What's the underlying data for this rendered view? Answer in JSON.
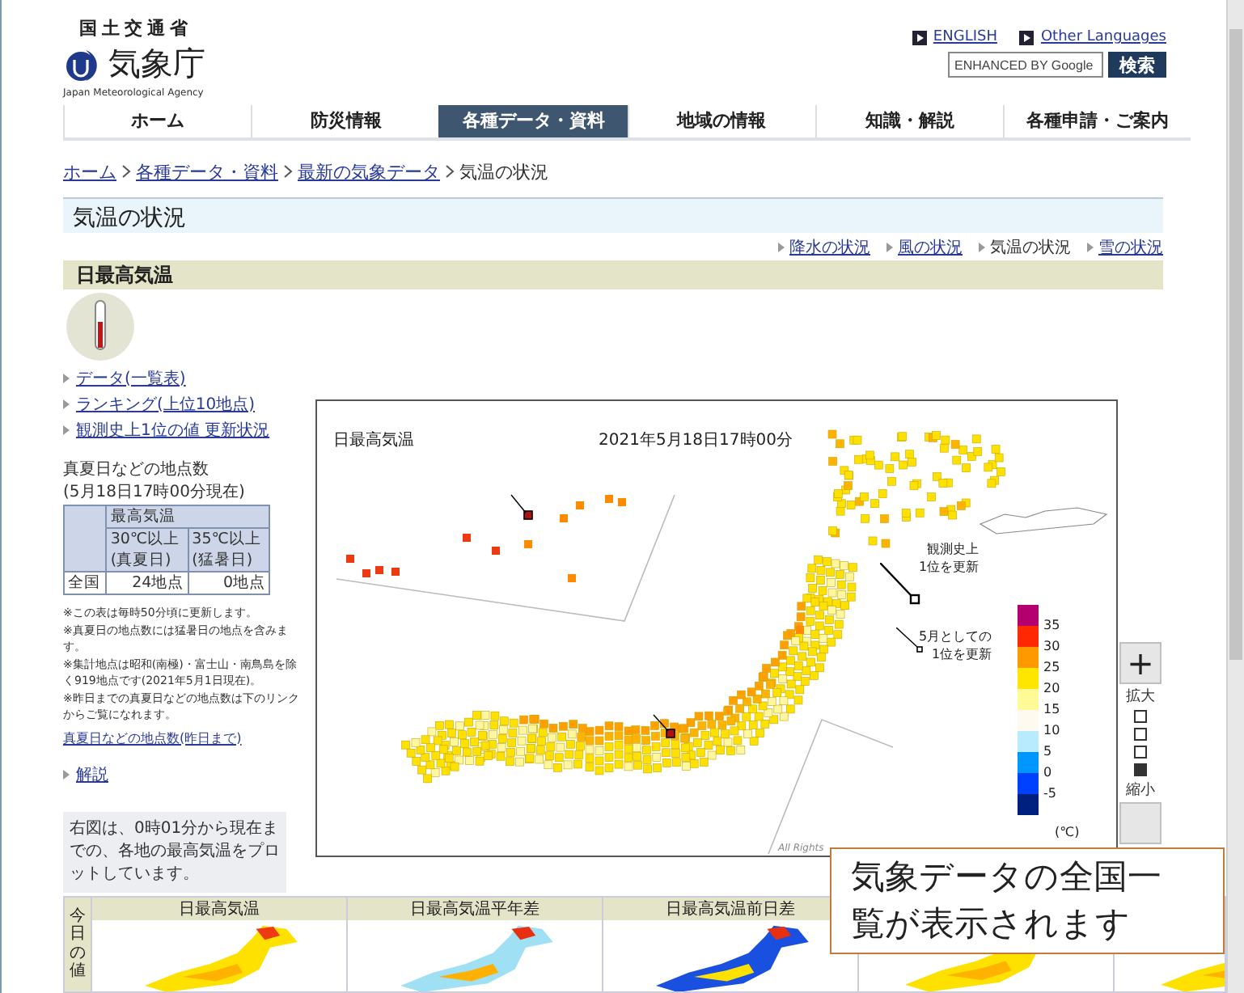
{
  "header": {
    "ministry": "国土交通省",
    "agency": "気象庁",
    "agency_en": "Japan Meteorological Agency",
    "links": [
      "ENGLISH",
      "Other Languages"
    ],
    "search": {
      "placeholder": "ENHANCED BY Google",
      "button": "検索"
    }
  },
  "nav": [
    {
      "label": "ホーム",
      "selected": false
    },
    {
      "label": "防災情報",
      "selected": false
    },
    {
      "label": "各種データ・資料",
      "selected": true
    },
    {
      "label": "地域の情報",
      "selected": false
    },
    {
      "label": "知識・解説",
      "selected": false
    },
    {
      "label": "各種申請・ご案内",
      "selected": false
    }
  ],
  "breadcrumb": [
    {
      "label": "ホーム",
      "current": false
    },
    {
      "label": "各種データ・資料",
      "current": false
    },
    {
      "label": "最新の気象データ",
      "current": false
    },
    {
      "label": "気温の状況",
      "current": true
    }
  ],
  "page_title": "気温の状況",
  "sub_links": [
    {
      "label": "降水の状況",
      "selected": false
    },
    {
      "label": "風の状況",
      "selected": false
    },
    {
      "label": "気温の状況",
      "selected": true
    },
    {
      "label": "雪の状況",
      "selected": false
    }
  ],
  "section_title": "日最高気温",
  "side_links": [
    "データ(一覧表)",
    "ランキング(上位10地点)",
    "観測史上1位の値 更新状況"
  ],
  "counts": {
    "title": "真夏日などの地点数",
    "as_of": "(5月18日17時00分現在)",
    "group": "最高気温",
    "columns": [
      [
        "30℃以上",
        "(真夏日)"
      ],
      [
        "35℃以上",
        "(猛暑日)"
      ]
    ],
    "rows": [
      {
        "region": "全国",
        "values": [
          "24地点",
          "0地点"
        ]
      }
    ]
  },
  "notes": [
    "※この表は毎時50分頃に更新します。",
    "※真夏日の地点数には猛暑日の地点を含みます。",
    "※集計地点は昭和(南極)・富士山・南鳥島を除く919地点です(2021年5月1日現在)。",
    "※昨日までの真夏日などの地点数は下のリンクからご覧になれます。"
  ],
  "past_link": "真夏日などの地点数(昨日まで)",
  "explain_link": "解説",
  "info": "右図は、0時01分から現在までの、各地の最高気温をプロットしています。",
  "map": {
    "title": "日最高気温",
    "time": "2021年5月18日17時00分",
    "annotations": [
      {
        "kind": "record",
        "lines": [
          "観測史上",
          "1位を更新"
        ]
      },
      {
        "kind": "month",
        "lines": [
          "5月としての",
          "1位を更新"
        ]
      }
    ],
    "legend": [
      {
        "label": "35",
        "color": "#b4006e"
      },
      {
        "label": "30",
        "color": "#ff2800"
      },
      {
        "label": "25",
        "color": "#ff9900"
      },
      {
        "label": "20",
        "color": "#ffe600"
      },
      {
        "label": "15",
        "color": "#fffa96"
      },
      {
        "label": "10",
        "color": "#fffaf0"
      },
      {
        "label": "5",
        "color": "#b9ebff"
      },
      {
        "label": "0",
        "color": "#0096ff"
      },
      {
        "label": "-5",
        "color": "#0041ff"
      },
      {
        "color": "#002080"
      }
    ],
    "unit": "(℃)",
    "copyright": "All Rights"
  },
  "zoom": {
    "in": "+",
    "in_label": "拡大",
    "levels": [
      {
        "selected": false
      },
      {
        "selected": false
      },
      {
        "selected": false
      },
      {
        "selected": true
      }
    ],
    "out_label": "縮小"
  },
  "thumbnails": {
    "side_label": "今日の値",
    "items": [
      {
        "title": "日最高気温",
        "kind": "temperature"
      },
      {
        "title": "日最高気温平年差",
        "kind": "anomaly"
      },
      {
        "title": "日最高気温前日差",
        "kind": "difference"
      },
      {
        "kind": "temperature"
      },
      {
        "kind": "temperature"
      }
    ]
  },
  "callout": "気象データの全国一覧が表示されます"
}
